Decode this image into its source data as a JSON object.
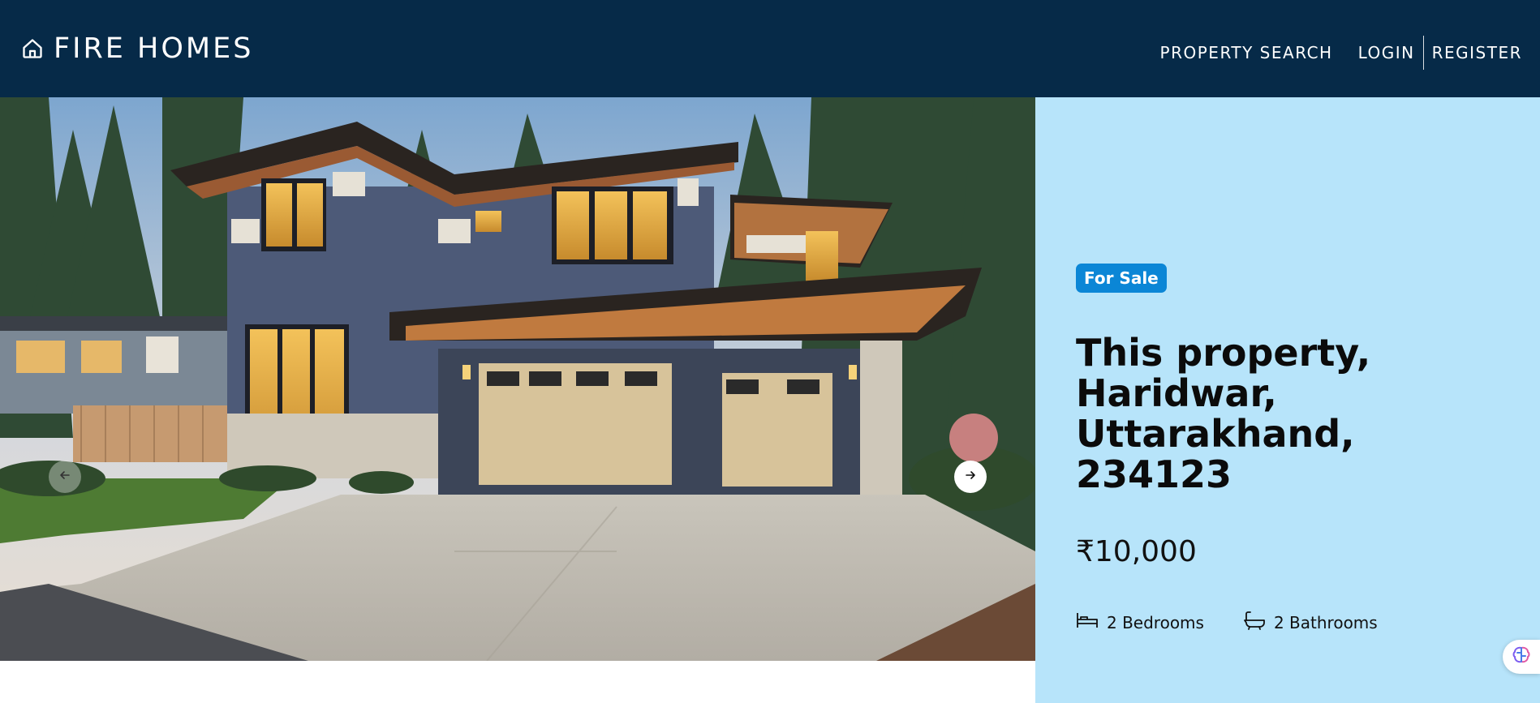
{
  "header": {
    "brand": "FIRE HOMES",
    "nav": {
      "property_search": "PROPERTY SEARCH",
      "login": "LOGIN",
      "register": "REGISTER"
    }
  },
  "hero": {
    "prev_icon": "arrow-left-icon",
    "next_icon": "arrow-right-icon"
  },
  "listing": {
    "status_badge": "For Sale",
    "title": "This property, Haridwar, Uttarakhand, 234123",
    "price": "₹10,000",
    "bedrooms": "2 Bedrooms",
    "bathrooms": "2 Bathrooms"
  },
  "colors": {
    "header_bg": "#062a48",
    "panel_bg": "#b7e4fa",
    "badge_bg": "#0b86d6"
  },
  "icons": {
    "brand": "home-icon",
    "bed": "bed-icon",
    "bath": "bathtub-icon",
    "widget": "brain-icon"
  }
}
